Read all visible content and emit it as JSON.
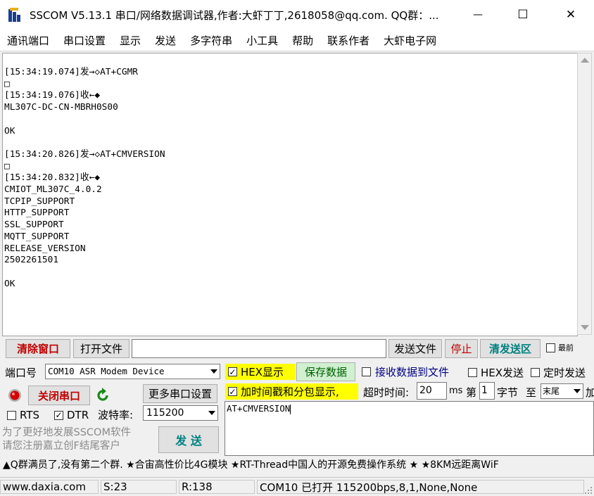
{
  "window": {
    "title": "SSCOM V5.13.1 串口/网络数据调试器,作者:大虾丁丁,2618058@qq.com. QQ群：...",
    "minimize_glyph": "—",
    "maximize_glyph": "☐",
    "close_glyph": "✕"
  },
  "menu": [
    "通讯端口",
    "串口设置",
    "显示",
    "发送",
    "多字符串",
    "小工具",
    "帮助",
    "联系作者",
    "大虾电子网"
  ],
  "receive": {
    "lines": [
      "[15:34:19.074]发→◇AT+CGMR",
      "□",
      "[15:34:19.076]收←◆",
      "ML307C-DC-CN-MBRH0S00",
      "",
      "OK",
      "",
      "[15:34:20.826]发→◇AT+CMVERSION",
      "□",
      "[15:34:20.832]收←◆",
      "CMIOT_ML307C_4.0.2",
      "TCPIP_SUPPORT",
      "HTTP_SUPPORT",
      "SSL_SUPPORT",
      "MQTT_SUPPORT",
      "RELEASE_VERSION",
      "2502261501",
      "",
      "OK"
    ]
  },
  "toolbar": {
    "clear_window": "清除窗口",
    "open_file": "打开文件",
    "file_path": "",
    "send_file": "发送文件",
    "stop": "停止",
    "clear_send_area": "清发送区",
    "topmost": "最前"
  },
  "port": {
    "port_label": "端口号",
    "port_value": "COM10 ASR Modem Device",
    "close_port": "关闭串口",
    "more_settings": "更多串口设置",
    "rts": "RTS",
    "dtr": "DTR",
    "baud_label": "波特率:",
    "baud_value": "115200",
    "promo_line1": "为了更好地发展SSCOM软件",
    "promo_line2": "请您注册嘉立创F结尾客户"
  },
  "options": {
    "hex_display": "HEX显示",
    "save_data": "保存数据",
    "recv_to_file": "接收数据到文件",
    "hex_send": "HEX发送",
    "timed_send": "定时发送",
    "add_timestamp": "加时间戳和分包显示,",
    "timeout_label": "超时时间:",
    "timeout_value": "20",
    "ms_unit": "ms",
    "nth_label": "第",
    "nth_value": "1",
    "byte_label": "字节",
    "to_label": "至",
    "to_value": "末尾",
    "add_label": "加"
  },
  "send": {
    "text": "AT+CMVERSION",
    "send_button": "发 送"
  },
  "ticker": "▲Q群满员了,没有第二个群. ★合宙高性价比4G模块 ★RT-Thread中国人的开源免费操作系统 ★ ★8KM远距离WiF",
  "status": {
    "website": "www.daxia.com",
    "sent": "S:23",
    "received": "R:138",
    "port_info": "COM10 已打开  115200bps,8,1,None,None"
  }
}
